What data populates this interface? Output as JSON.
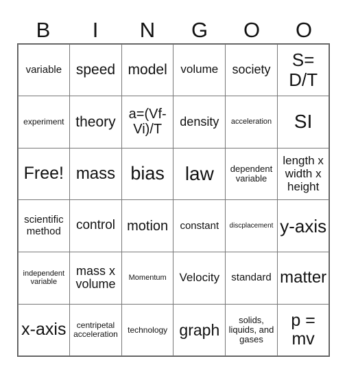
{
  "header": [
    "B",
    "I",
    "N",
    "G",
    "O",
    "O"
  ],
  "cells": [
    "variable",
    "speed",
    "model",
    "volume",
    "society",
    "S= D/T",
    "experiment",
    "theory",
    "a=(Vf-Vi)/T",
    "density",
    "acceleration",
    "SI",
    "Free!",
    "mass",
    "bias",
    "law",
    "dependent variable",
    "length x width x height",
    "scientific method",
    "control",
    "motion",
    "constant",
    "discplacement",
    "y-axis",
    "independent variable",
    "mass x volume",
    "Momentum",
    "Velocity",
    "standard",
    "matter",
    "x-axis",
    "centripetal acceleration",
    "technology",
    "graph",
    "solids, liquids, and gases",
    "p = mv"
  ]
}
